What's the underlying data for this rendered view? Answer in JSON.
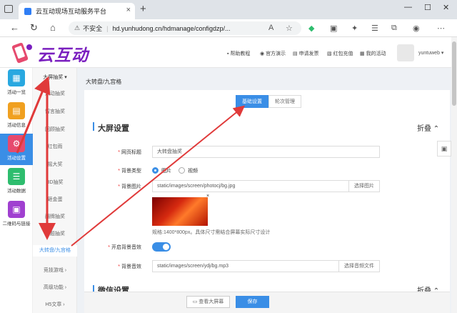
{
  "browser": {
    "tab_title": "云互动现场互动服务平台",
    "not_secure": "不安全",
    "url": "hd.yunhudong.cn/hdmanage/configdzp/..."
  },
  "site": {
    "logo": "云互动",
    "nav": [
      "帮助教程",
      "官方演示",
      "申请发票",
      "红包充值",
      "我的活动"
    ],
    "username": "yuntuweb"
  },
  "leftbar": [
    {
      "label": "活动一览",
      "icon": "grid-icon",
      "color": "#29a8e0"
    },
    {
      "label": "活动信息",
      "icon": "document-icon",
      "color": "#f0a020"
    },
    {
      "label": "活动设置",
      "icon": "gear-icon",
      "color": "#e64a6e",
      "active": true
    },
    {
      "label": "活动数据",
      "icon": "database-icon",
      "color": "#2ebd6e"
    },
    {
      "label": "二维码与链接",
      "icon": "qrcode-icon",
      "color": "#a040d0"
    }
  ],
  "submenu": {
    "group": "大屏抽奖",
    "items": [
      "滚动抽奖",
      "留言抽奖",
      "回顾抽奖",
      "红包雨",
      "摇大奖",
      "3D抽奖",
      "砸金蛋",
      "翻牌抽奖",
      "答题抽奖",
      "大转盘/九宫格"
    ],
    "after": [
      "竞技游戏",
      "高级功能",
      "H5文章"
    ]
  },
  "breadcrumb": "大转盘/九宫格",
  "tabs": [
    "基础设置",
    "轮次管理"
  ],
  "screen_section": {
    "title": "大屏设置",
    "fold": "折叠",
    "fields": {
      "page_title_label": "网页标题",
      "page_title_value": "大转盘抽奖",
      "bg_type_label": "背景类型",
      "bg_type_options": [
        "图片",
        "视频"
      ],
      "bg_image_label": "背景图片",
      "bg_image_value": "static/images/screen/photocj/bg.jpg",
      "bg_image_btn": "选择图片",
      "close_x": "×",
      "hint": "规格:1400*800px。具体尺寸需结合屏幕实际尺寸设计",
      "music_toggle_label": "开启背景音效",
      "music_label": "背景音效",
      "music_value": "static/images/screen/ydj/bg.mp3",
      "music_btn": "选择音频文件"
    }
  },
  "wechat_section": {
    "title": "微信设置",
    "fold": "折叠"
  },
  "footer": {
    "preview": "查看大屏幕",
    "save": "保存"
  }
}
